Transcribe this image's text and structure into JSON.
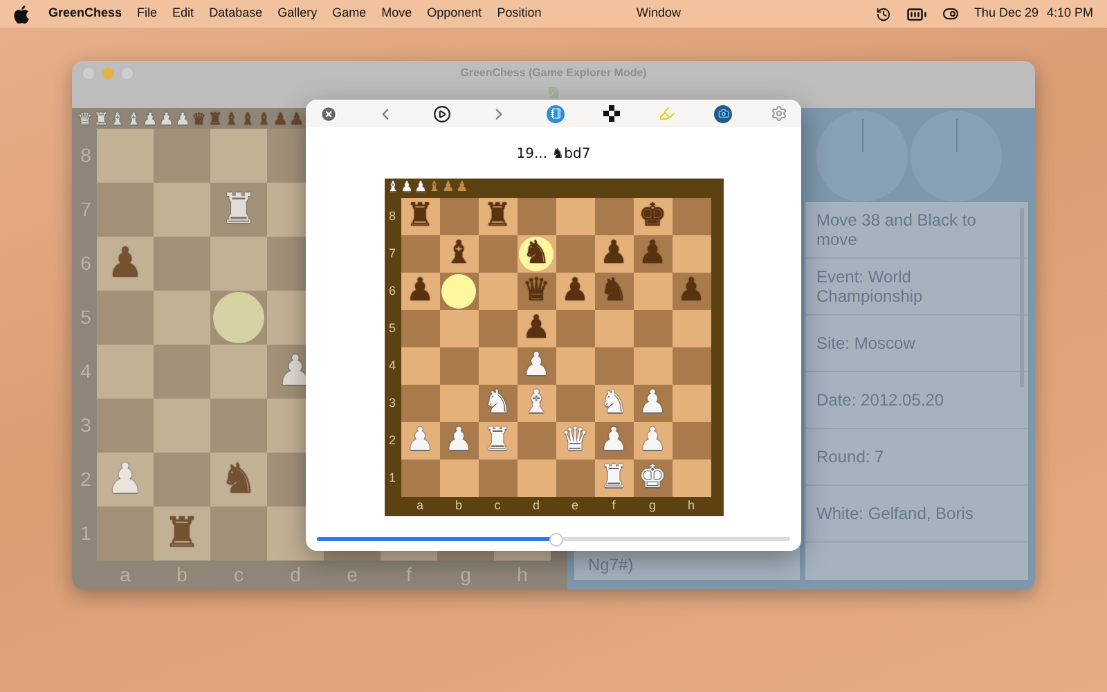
{
  "menu_bar": {
    "app_name": "GreenChess",
    "menus": [
      "File",
      "Edit",
      "Database",
      "Gallery",
      "Game",
      "Move",
      "Opponent",
      "Position"
    ],
    "window_menu": "Window",
    "date": "Thu Dec 29",
    "time": "4:10 PM"
  },
  "window": {
    "title": "GreenChess (Game Explorer Mode)"
  },
  "main_board": {
    "captured": [
      {
        "piece": "♛",
        "white": true
      },
      {
        "piece": "♜",
        "white": true
      },
      {
        "piece": "♝",
        "white": true
      },
      {
        "piece": "♝",
        "white": true
      },
      {
        "piece": "♟",
        "white": true
      },
      {
        "piece": "♟",
        "white": true
      },
      {
        "piece": "♟",
        "white": true
      },
      {
        "piece": "♛",
        "white": false
      },
      {
        "piece": "♜",
        "white": false
      },
      {
        "piece": "♝",
        "white": false
      },
      {
        "piece": "♝",
        "white": false
      },
      {
        "piece": "♝",
        "white": false
      },
      {
        "piece": "♟",
        "white": false
      },
      {
        "piece": "♟",
        "white": false
      }
    ],
    "rows": [
      {
        "rank": "8",
        "squares": [
          {
            "dark": false
          },
          {
            "dark": true
          },
          {
            "dark": false
          },
          {
            "dark": true
          }
        ]
      },
      {
        "rank": "7",
        "squares": [
          {
            "dark": true
          },
          {
            "dark": false
          },
          {
            "dark": true,
            "piece": "♜",
            "white": true
          },
          {
            "dark": false
          }
        ]
      },
      {
        "rank": "6",
        "squares": [
          {
            "dark": false,
            "piece": "♟",
            "white": false
          },
          {
            "dark": true
          },
          {
            "dark": false
          },
          {
            "dark": true
          }
        ]
      },
      {
        "rank": "5",
        "squares": [
          {
            "dark": true
          },
          {
            "dark": false
          },
          {
            "dark": true,
            "dot": true
          },
          {
            "dark": false
          }
        ]
      },
      {
        "rank": "4",
        "squares": [
          {
            "dark": false
          },
          {
            "dark": true
          },
          {
            "dark": false
          },
          {
            "dark": true,
            "piece": "♟",
            "white": true
          }
        ]
      },
      {
        "rank": "3",
        "squares": [
          {
            "dark": true
          },
          {
            "dark": false
          },
          {
            "dark": true
          },
          {
            "dark": false
          }
        ]
      },
      {
        "rank": "2",
        "squares": [
          {
            "dark": false,
            "piece": "♟",
            "white": true
          },
          {
            "dark": true
          },
          {
            "dark": false,
            "piece": "♞",
            "white": false
          },
          {
            "dark": true
          }
        ]
      },
      {
        "rank": "1",
        "squares": [
          {
            "dark": true
          },
          {
            "dark": false,
            "piece": "♜",
            "white": false
          },
          {
            "dark": true
          },
          {
            "dark": false
          },
          {
            "dark": true
          },
          {
            "dark": false
          },
          {
            "dark": true
          },
          {
            "dark": false
          }
        ]
      }
    ],
    "files": [
      "a",
      "b",
      "c",
      "d",
      "e",
      "f",
      "g",
      "h"
    ]
  },
  "move_list": {
    "text": "Ng7#)"
  },
  "game_info": {
    "items": [
      "Move 38 and Black to move",
      "Event:  World Championship",
      "Site:  Moscow",
      "Date:  2012.05.20",
      "Round:  7",
      "White:  Gelfand, Boris"
    ]
  },
  "popup": {
    "title": "19... ♞bd7",
    "board": {
      "captured": [
        {
          "piece": "♝",
          "white": true
        },
        {
          "piece": "♟",
          "white": true
        },
        {
          "piece": "♟",
          "white": true
        },
        {
          "piece": "♝",
          "white": false
        },
        {
          "piece": "♟",
          "white": false
        },
        {
          "piece": "♟",
          "white": false
        }
      ],
      "rows": [
        {
          "rank": "8",
          "squares": [
            {
              "dark": false,
              "piece": "♜",
              "white": false
            },
            {
              "dark": true
            },
            {
              "dark": false,
              "piece": "♜",
              "white": false
            },
            {
              "dark": true
            },
            {
              "dark": false
            },
            {
              "dark": true
            },
            {
              "dark": false,
              "piece": "♚",
              "white": false
            },
            {
              "dark": true
            }
          ]
        },
        {
          "rank": "7",
          "squares": [
            {
              "dark": true
            },
            {
              "dark": false,
              "piece": "♝",
              "white": false
            },
            {
              "dark": true
            },
            {
              "dark": false,
              "piece": "♞",
              "white": false,
              "glow": true
            },
            {
              "dark": true
            },
            {
              "dark": false,
              "piece": "♟",
              "white": false
            },
            {
              "dark": true,
              "piece": "♟",
              "white": false
            },
            {
              "dark": false
            }
          ]
        },
        {
          "rank": "6",
          "squares": [
            {
              "dark": false,
              "piece": "♟",
              "white": false
            },
            {
              "dark": true,
              "dot": true
            },
            {
              "dark": false
            },
            {
              "dark": true,
              "piece": "♛",
              "white": false
            },
            {
              "dark": false,
              "piece": "♟",
              "white": false
            },
            {
              "dark": true,
              "piece": "♞",
              "white": false
            },
            {
              "dark": false
            },
            {
              "dark": true,
              "piece": "♟",
              "white": false
            }
          ]
        },
        {
          "rank": "5",
          "squares": [
            {
              "dark": true
            },
            {
              "dark": false
            },
            {
              "dark": true
            },
            {
              "dark": false,
              "piece": "♟",
              "white": false
            },
            {
              "dark": true
            },
            {
              "dark": false
            },
            {
              "dark": true
            },
            {
              "dark": false
            }
          ]
        },
        {
          "rank": "4",
          "squares": [
            {
              "dark": false
            },
            {
              "dark": true
            },
            {
              "dark": false
            },
            {
              "dark": true,
              "piece": "♟",
              "white": true
            },
            {
              "dark": false
            },
            {
              "dark": true
            },
            {
              "dark": false
            },
            {
              "dark": true
            }
          ]
        },
        {
          "rank": "3",
          "squares": [
            {
              "dark": true
            },
            {
              "dark": false
            },
            {
              "dark": true,
              "piece": "♞",
              "white": true
            },
            {
              "dark": false,
              "piece": "♝",
              "white": true
            },
            {
              "dark": true
            },
            {
              "dark": false,
              "piece": "♞",
              "white": true
            },
            {
              "dark": true,
              "piece": "♟",
              "white": true
            },
            {
              "dark": false
            }
          ]
        },
        {
          "rank": "2",
          "squares": [
            {
              "dark": false,
              "piece": "♟",
              "white": true
            },
            {
              "dark": true,
              "piece": "♟",
              "white": true
            },
            {
              "dark": false,
              "piece": "♜",
              "white": true
            },
            {
              "dark": true
            },
            {
              "dark": false,
              "piece": "♛",
              "white": true
            },
            {
              "dark": true,
              "piece": "♟",
              "white": true
            },
            {
              "dark": false,
              "piece": "♟",
              "white": true
            },
            {
              "dark": true
            }
          ]
        },
        {
          "rank": "1",
          "squares": [
            {
              "dark": true
            },
            {
              "dark": false
            },
            {
              "dark": true
            },
            {
              "dark": false
            },
            {
              "dark": true
            },
            {
              "dark": false,
              "piece": "♜",
              "white": true
            },
            {
              "dark": true,
              "piece": "♚",
              "white": true
            },
            {
              "dark": false
            }
          ]
        }
      ],
      "files": [
        "a",
        "b",
        "c",
        "d",
        "e",
        "f",
        "g",
        "h"
      ]
    },
    "slider": {
      "level": 0.506
    }
  }
}
